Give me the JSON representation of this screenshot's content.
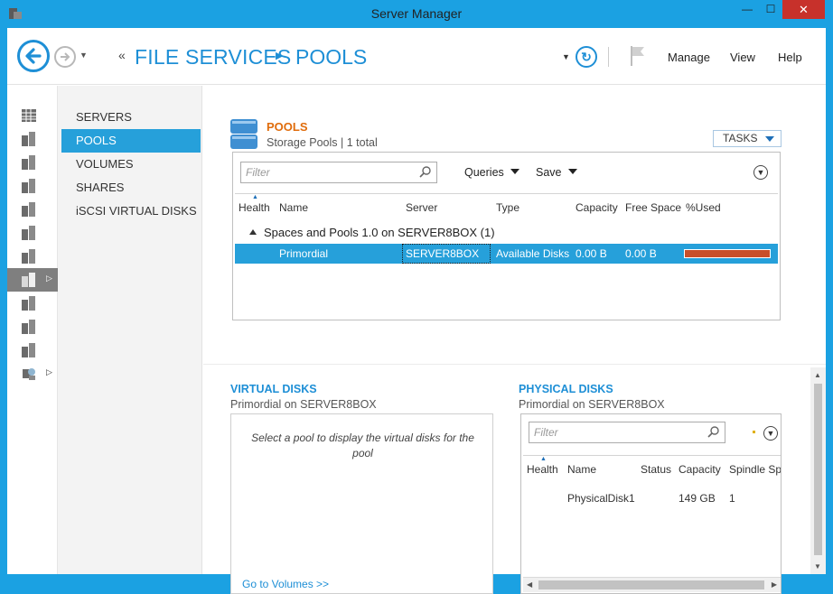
{
  "window": {
    "title": "Server Manager",
    "minimize": "—",
    "maximize": "☐",
    "close": "✕"
  },
  "header": {
    "breadcrumb_parent": "FILE SERVICES",
    "breadcrumb_current": "POOLS",
    "menu": [
      "Manage",
      "View",
      "Help"
    ]
  },
  "subnav": {
    "items": [
      "SERVERS",
      "POOLS",
      "VOLUMES",
      "SHARES",
      "iSCSI VIRTUAL DISKS"
    ],
    "selected": "POOLS"
  },
  "pools": {
    "title": "POOLS",
    "subtitle": "Storage Pools | 1 total",
    "tasks_label": "TASKS",
    "filter_placeholder": "Filter",
    "queries_label": "Queries",
    "save_label": "Save",
    "columns": [
      "Health",
      "Name",
      "Server",
      "Type",
      "Capacity",
      "Free Space",
      "%Used"
    ],
    "group_label": "Spaces and Pools 1.0 on SERVER8BOX (1)",
    "rows": [
      {
        "name": "Primordial",
        "server": "SERVER8BOX",
        "type": "Available Disks",
        "capacity": "0.00 B",
        "free_space": "0.00 B",
        "used_fraction": 1.0
      }
    ]
  },
  "virtual_disks": {
    "title": "VIRTUAL DISKS",
    "subtitle": "Primordial on SERVER8BOX",
    "empty_message": "Select a pool to display the virtual disks for the pool",
    "link": "Go to Volumes >>"
  },
  "physical_disks": {
    "title": "PHYSICAL DISKS",
    "subtitle": "Primordial on SERVER8BOX",
    "filter_placeholder": "Filter",
    "columns": [
      "Health",
      "Name",
      "Status",
      "Capacity",
      "Spindle Spe"
    ],
    "rows": [
      {
        "name": "PhysicalDisk1",
        "status": "",
        "capacity": "149 GB",
        "spindle": "1"
      }
    ]
  },
  "colors": {
    "accent": "#1e8fd6",
    "selection": "#26a0da",
    "pools_title": "#e06c0b",
    "used_bar": "#c84f2a",
    "close": "#c7312b"
  }
}
